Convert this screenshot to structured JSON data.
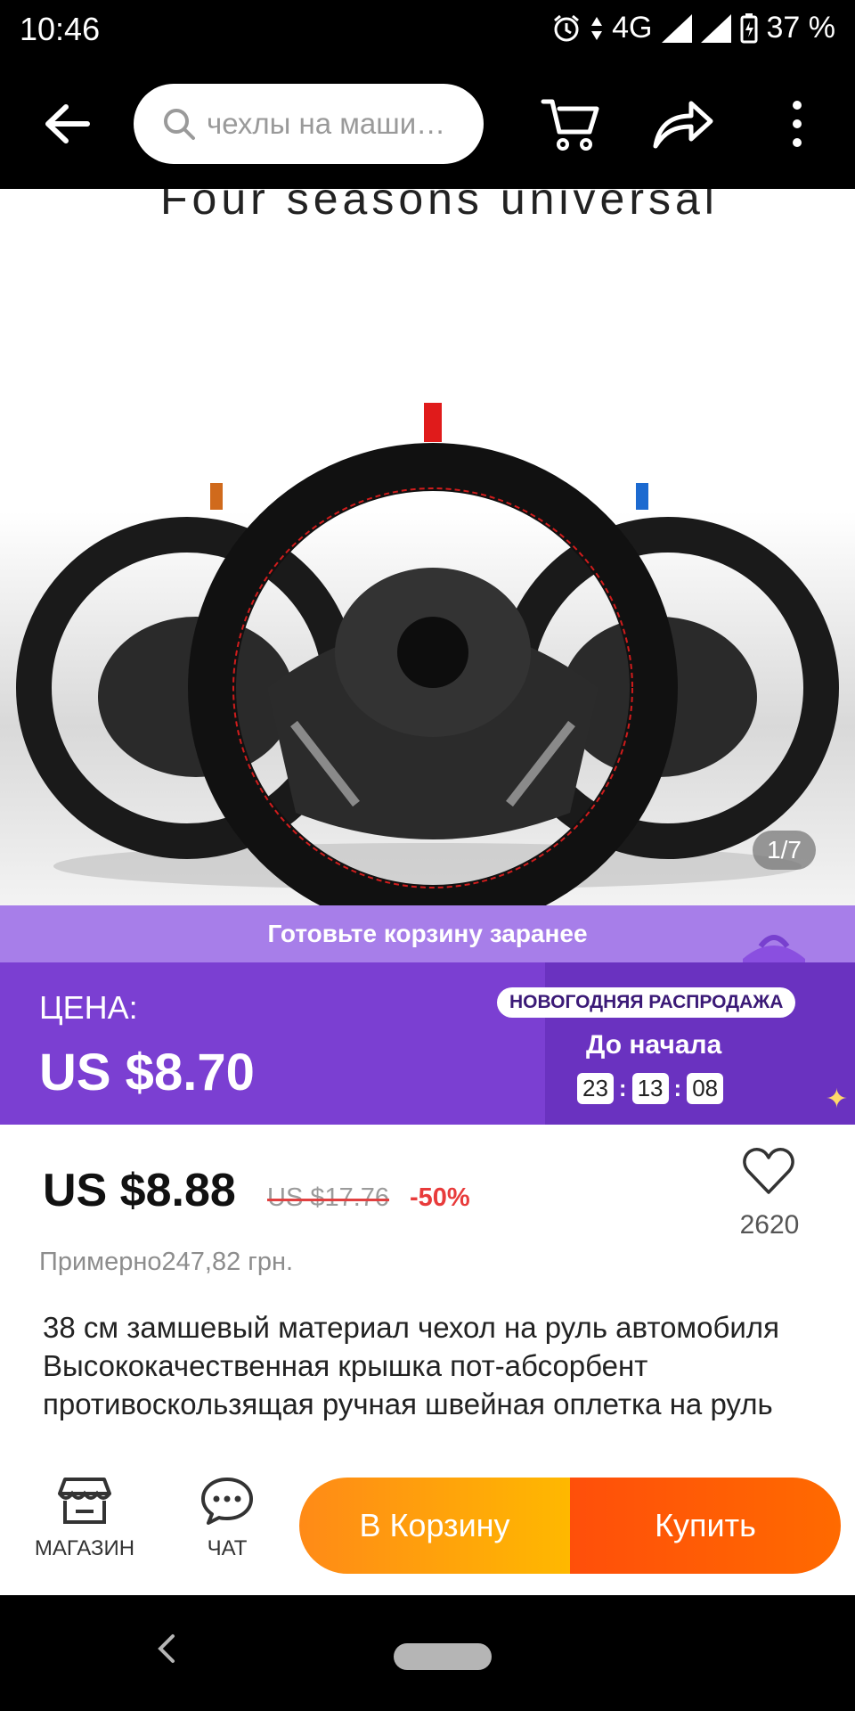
{
  "status_bar": {
    "time": "10:46",
    "network": "4G",
    "battery": "37 %"
  },
  "nav": {
    "search_placeholder": "чехлы на маши…"
  },
  "product_image": {
    "banner_text": "Four seasons universal",
    "counter": "1/7"
  },
  "promo": {
    "strip_text": "Готовьте корзину заранее"
  },
  "price_block": {
    "label": "ЦЕНА:",
    "price": "US $8.70",
    "sale_badge": "НОВОГОДНЯЯ РАСПРОДАЖА",
    "sale_start_label": "До начала",
    "timer": {
      "hours": "23",
      "minutes": "13",
      "seconds": "08"
    }
  },
  "details": {
    "current_price": "US $8.88",
    "old_price": "US $17.76",
    "discount": "-50%",
    "wishlist_count": "2620",
    "approx_price": "Примерно247,82 грн.",
    "title": "38 см замшевый материал чехол на руль автомобиля Высококачественная крышка пот-абсорбент противоскользящая ручная швейная оплетка на руль"
  },
  "action_bar": {
    "store_label": "МАГАЗИН",
    "chat_label": "ЧАТ",
    "add_to_cart_label": "В Корзину",
    "buy_label": "Купить"
  },
  "colors": {
    "price_bg": "#7b3fd2",
    "promo_bg": "#a77ee9",
    "add_cart": "#ff9a0d",
    "buy": "#ff5a05",
    "discount": "#e83b3b"
  }
}
